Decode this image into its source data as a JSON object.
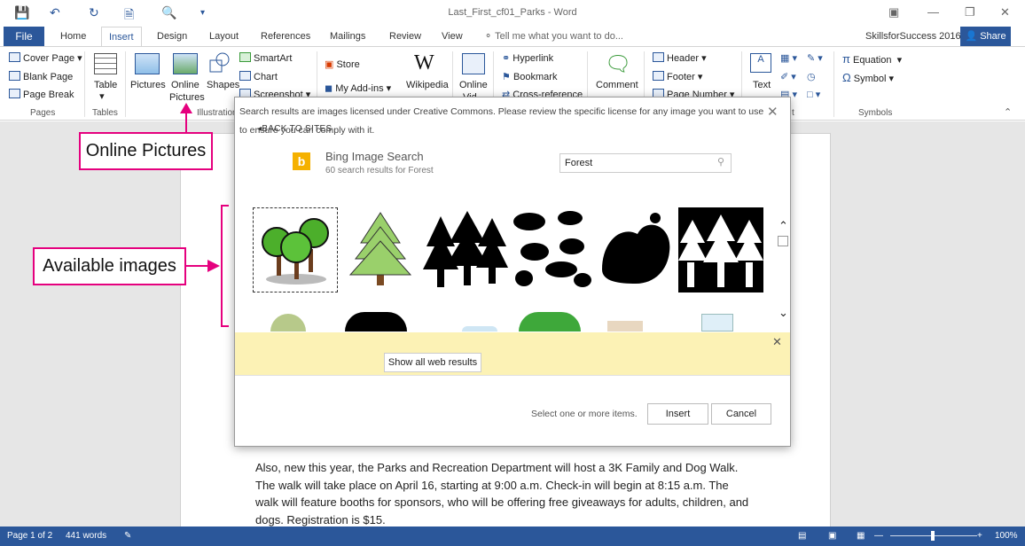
{
  "window": {
    "title": "Last_First_cf01_Parks - Word"
  },
  "tabs": {
    "file": "File",
    "home": "Home",
    "insert": "Insert",
    "design": "Design",
    "layout": "Layout",
    "references": "References",
    "mailings": "Mailings",
    "review": "Review",
    "view": "View",
    "tell_me": "Tell me what you want to do...",
    "account": "SkillsforSuccess 2016",
    "share": "Share"
  },
  "ribbon": {
    "pages": {
      "cover": "Cover Page",
      "blank": "Blank Page",
      "break": "Page Break",
      "group": "Pages"
    },
    "tables": {
      "table": "Table",
      "group": "Tables"
    },
    "illustrations": {
      "pictures": "Pictures",
      "online1": "Online",
      "online2": "Pictures",
      "shapes": "Shapes",
      "smartart": "SmartArt",
      "chart": "Chart",
      "screenshot": "Screenshot",
      "group": "Illustration"
    },
    "addins": {
      "store": "Store",
      "myaddins": "My Add-ins",
      "wikipedia": "Wikipedia"
    },
    "media": {
      "online": "Online",
      "video": "Vid"
    },
    "links": {
      "hyperlink": "Hyperlink",
      "bookmark": "Bookmark",
      "crossref": "Cross-reference"
    },
    "comments": {
      "comment": "Comment"
    },
    "header_footer": {
      "header": "Header",
      "footer": "Footer",
      "pagenumber": "Page Number"
    },
    "text": {
      "text": "Text",
      "group_t": "t"
    },
    "symbols": {
      "equation": "Equation",
      "symbol": "Symbol",
      "group": "Symbols"
    }
  },
  "dialog": {
    "back": "BACK TO SITES",
    "provider": "Bing Image Search",
    "count": "60 search results for Forest",
    "search_value": "Forest",
    "notice": "Search results are images licensed under Creative Commons. Please review the specific license for any image you want to use to ensure you can comply with it.",
    "show_all": "Show all web results",
    "select_prompt": "Select one or more items.",
    "insert": "Insert",
    "cancel": "Cancel"
  },
  "document": {
    "paragraph": "Also, new this year, the Parks and Recreation Department will host a 3K Family and Dog Walk. The walk will take place on April 16, starting at 9:00 a.m. Check-in will begin at 8:15 a.m. The walk will feature booths for sponsors, who will be offering free giveaways for adults, children, and dogs. Registration is $15."
  },
  "status": {
    "page": "Page 1 of 2",
    "words": "441 words",
    "zoom": "100%"
  },
  "callouts": {
    "online_pictures": "Online Pictures",
    "available_images": "Available images"
  },
  "colors": {
    "accent": "#2b579a",
    "callout": "#e5007e",
    "notice": "#fcf2b5"
  }
}
